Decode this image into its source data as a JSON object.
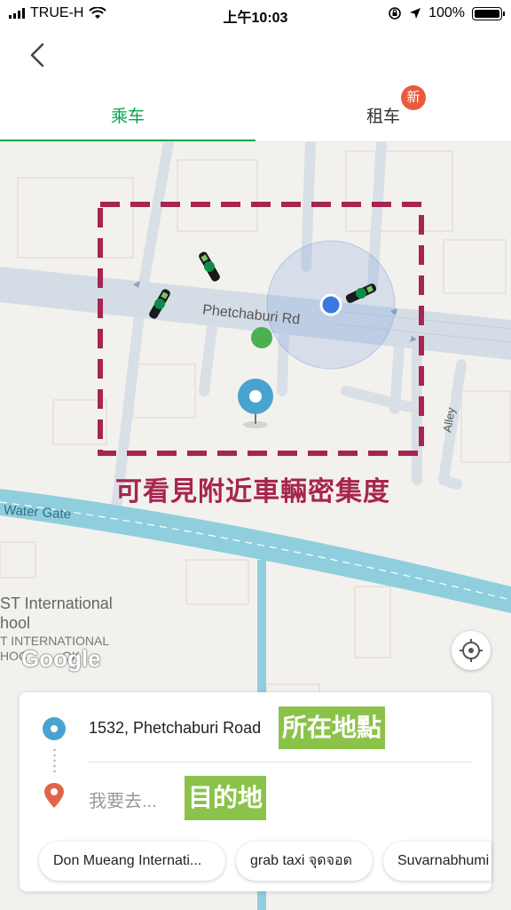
{
  "status_bar": {
    "carrier": "TRUE-H",
    "time": "上午10:03",
    "battery": "100%"
  },
  "header": {
    "tabs": [
      {
        "label": "乘车"
      },
      {
        "label": "租车",
        "badge": "新"
      }
    ]
  },
  "map": {
    "road_label": "Phetchaburi Rd",
    "water_label": "Water Gate",
    "alley_label": "Alley",
    "school_label_1": "ST International",
    "school_label_2": "hool",
    "school_label_3": "T INTERNATIONAL",
    "school_label_4": "HOC          OK",
    "google_logo": "Google",
    "density_annotation": "可看見附近車輛密集度"
  },
  "booking": {
    "pickup_address": "1532, Phetchaburi Road",
    "pickup_annotation": "所在地點",
    "destination_placeholder": "我要去...",
    "destination_annotation": "目的地",
    "shortcuts": [
      {
        "label": "Don Mueang Internati..."
      },
      {
        "label": "grab taxi จุดจอด"
      },
      {
        "label": "Suvarnabhumi"
      }
    ]
  },
  "colors": {
    "accent": "#00a84f",
    "annotation": "#a7254f",
    "highlight": "#8bc34a",
    "badge": "#e95a3d"
  }
}
